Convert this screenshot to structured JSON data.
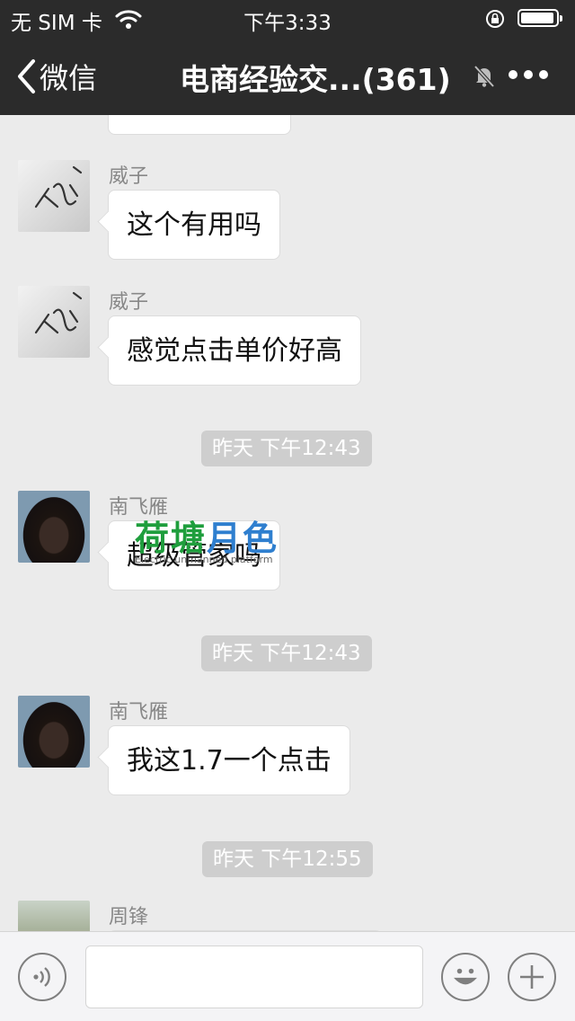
{
  "status_bar": {
    "carrier": "无 SIM 卡",
    "time": "下午3:33"
  },
  "nav": {
    "back_label": "微信",
    "title": "电商经验交...(361)"
  },
  "messages": [
    {
      "sender": "威子",
      "text": "这个有用吗"
    },
    {
      "sender": "威子",
      "text": "感觉点击单价好高"
    },
    {
      "timestamp": "昨天 下午12:43"
    },
    {
      "sender": "南飞雁",
      "text": "超级管家吗"
    },
    {
      "timestamp": "昨天 下午12:43"
    },
    {
      "sender": "南飞雁",
      "text": "我这1.7一个点击"
    },
    {
      "timestamp": "昨天 下午12:55"
    },
    {
      "sender": "周锋",
      "text": ""
    }
  ],
  "watermark": {
    "brand_a": "荷塘",
    "brand_b": "月色",
    "tagline": "Electric unmanned platform"
  },
  "input": {
    "value": ""
  },
  "colors": {
    "nav_bg": "#2b2b2b",
    "chat_bg": "#ebebeb",
    "bubble_bg": "#ffffff",
    "timestamp_bg": "#cecece"
  }
}
